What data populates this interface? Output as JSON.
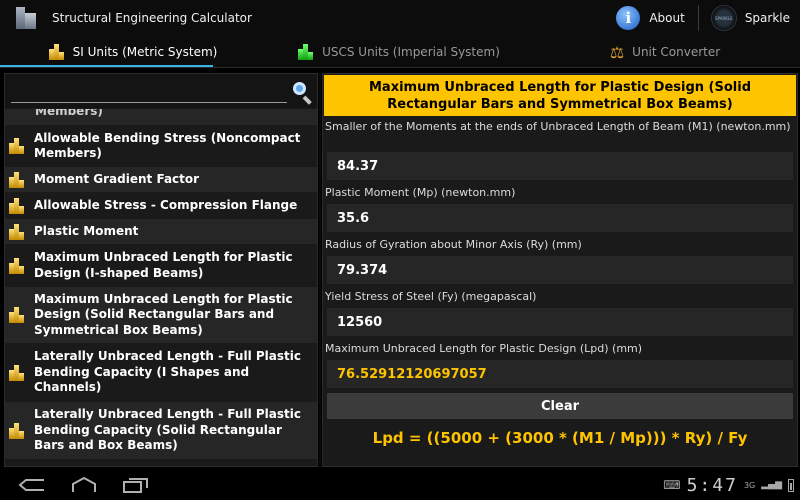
{
  "app": {
    "title": "Structural Engineering Calculator",
    "about_label": "About",
    "sparkle_label": "Sparkle",
    "sparkle_logo_text": "SPARKLE"
  },
  "tabs": [
    {
      "label": "SI Units (Metric System)",
      "icon": "gold-bars-icon",
      "active": true
    },
    {
      "label": "USCS Units (Imperial System)",
      "icon": "green-bars-icon",
      "active": false
    },
    {
      "label": "Unit Converter",
      "icon": "scale-icon",
      "active": false
    }
  ],
  "search": {
    "value": "",
    "placeholder": ""
  },
  "list": {
    "partial_item": "Members)",
    "items": [
      {
        "label": "Allowable Bending Stress (Noncompact Members)"
      },
      {
        "label": "Moment Gradient Factor"
      },
      {
        "label": "Allowable Stress - Compression Flange"
      },
      {
        "label": "Plastic Moment"
      },
      {
        "label": "Maximum Unbraced Length for Plastic Design (I-shaped Beams)"
      },
      {
        "label": "Maximum Unbraced Length for Plastic Design (Solid Rectangular Bars and Symmetrical Box Beams)"
      },
      {
        "label": "Laterally Unbraced Length - Full Plastic Bending Capacity (I Shapes and Channels)"
      },
      {
        "label": "Laterally Unbraced Length - Full Plastic Bending Capacity (Solid Rectangular Bars and Box Beams)"
      }
    ]
  },
  "form": {
    "title": "Maximum Unbraced Length for Plastic Design (Solid Rectangular Bars and Symmetrical Box Beams)",
    "fields": [
      {
        "label": "Smaller of the Moments at the ends of Unbraced Length of Beam (M1) (newton.mm)",
        "value": "84.37"
      },
      {
        "label": "Plastic Moment (Mp) (newton.mm)",
        "value": "35.6"
      },
      {
        "label": "Radius of Gyration about Minor Axis (Ry) (mm)",
        "value": "79.374"
      },
      {
        "label": "Yield Stress of Steel (Fy) (megapascal)",
        "value": "12560"
      }
    ],
    "result": {
      "label": "Maximum Unbraced Length for Plastic Design (Lpd) (mm)",
      "value": "76.52912120697057"
    },
    "clear_label": "Clear",
    "formula": "Lpd = ((5000 + (3000 * (M1 / Mp))) * Ry) / Fy"
  },
  "statusbar": {
    "time": "5:47",
    "network": "3G"
  },
  "colors": {
    "accent_yellow": "#ffc400",
    "tab_indicator": "#33b5e5",
    "background": "#000000"
  }
}
